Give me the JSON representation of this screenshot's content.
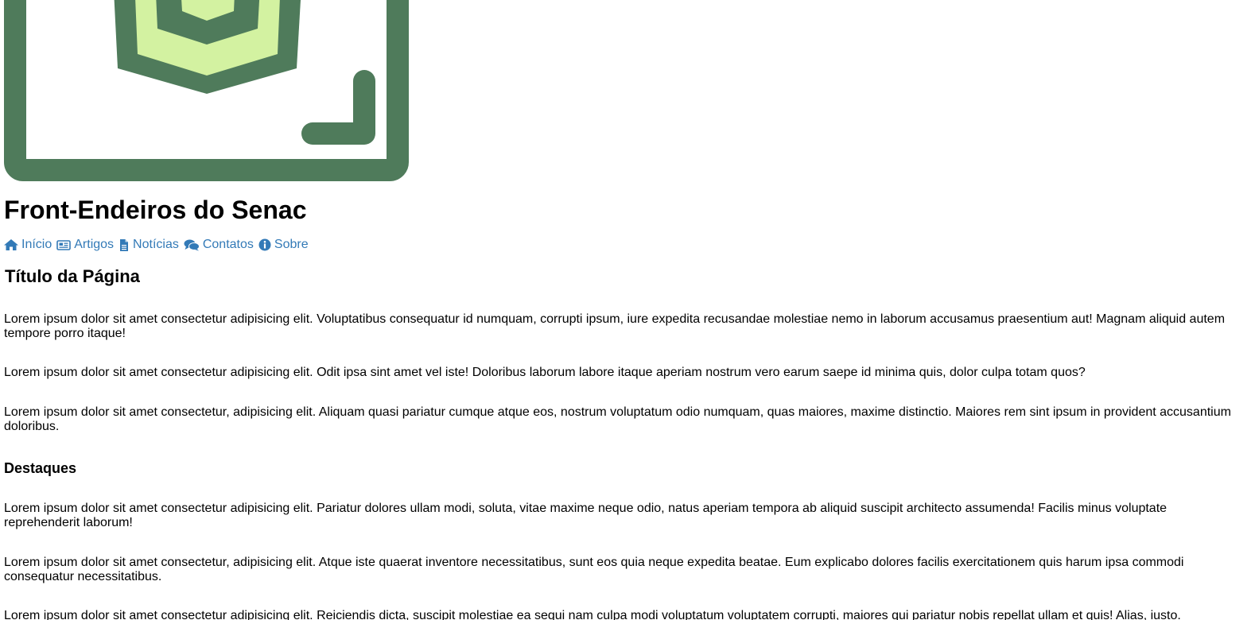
{
  "header": {
    "site_title": "Front-Endeiros do Senac"
  },
  "logo": {
    "colors": {
      "frame": "#4f7b5b",
      "accent": "#d3f2a1"
    }
  },
  "nav": {
    "link_color": "#337ab7",
    "items": [
      {
        "label": "Início",
        "icon": "home-icon"
      },
      {
        "label": "Artigos",
        "icon": "newspaper-icon"
      },
      {
        "label": "Notícias",
        "icon": "document-icon"
      },
      {
        "label": "Contatos",
        "icon": "comments-icon"
      },
      {
        "label": "Sobre",
        "icon": "info-icon"
      }
    ]
  },
  "main": {
    "page_title": "Título da Página",
    "paragraphs": [
      "Lorem ipsum dolor sit amet consectetur adipisicing elit. Voluptatibus consequatur id numquam, corrupti ipsum, iure expedita recusandae molestiae nemo in laborum accusamus praesentium aut! Magnam aliquid autem tempore porro itaque!",
      "Lorem ipsum dolor sit amet consectetur adipisicing elit. Odit ipsa sint amet vel iste! Doloribus laborum labore itaque aperiam nostrum vero earum saepe id minima quis, dolor culpa totam quos?",
      "Lorem ipsum dolor sit amet consectetur, adipisicing elit. Aliquam quasi pariatur cumque atque eos, nostrum voluptatum odio numquam, quas maiores, maxime distinctio. Maiores rem sint ipsum in provident accusantium doloribus."
    ],
    "highlights_title": "Destaques",
    "highlights": [
      "Lorem ipsum dolor sit amet consectetur adipisicing elit. Pariatur dolores ullam modi, soluta, vitae maxime neque odio, natus aperiam tempora ab aliquid suscipit architecto assumenda! Facilis minus voluptate reprehenderit laborum!",
      "Lorem ipsum dolor sit amet consectetur, adipisicing elit. Atque iste quaerat inventore necessitatibus, sunt eos quia neque expedita beatae. Eum explicabo dolores facilis exercitationem quis harum ipsa commodi consequatur necessitatibus.",
      "Lorem ipsum dolor sit amet consectetur adipisicing elit. Reiciendis dicta, suscipit molestiae ea sequi nam culpa modi voluptatum voluptatem corrupti, maiores qui pariatur nobis repellat ullam et quis! Alias, iusto."
    ]
  }
}
